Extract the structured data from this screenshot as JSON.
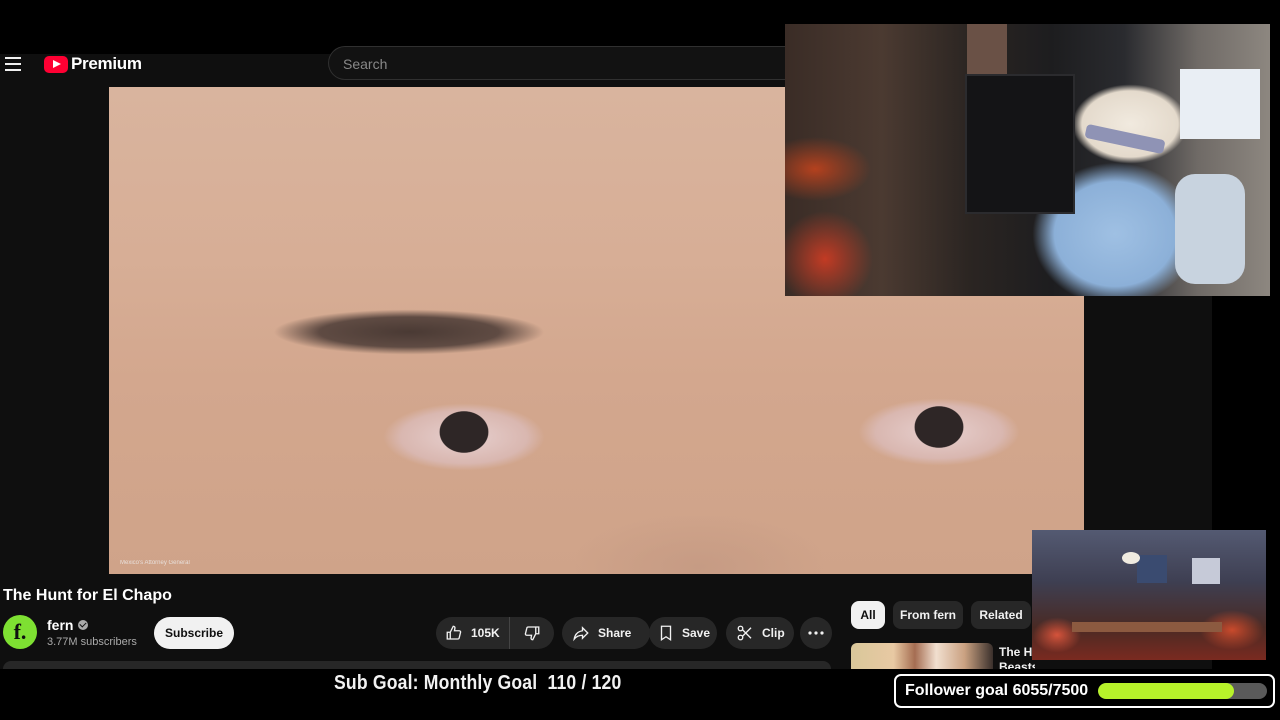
{
  "youtube": {
    "brand": "Premium",
    "search": {
      "placeholder": "Search"
    },
    "video": {
      "credit": "Mexico's Attorney General"
    },
    "title": "The Hunt for El Chapo",
    "channel": {
      "avatar_letter": "f.",
      "name": "fern",
      "subscribers": "3.77M subscribers",
      "subscribe_label": "Subscribe"
    },
    "actions": {
      "like_count": "105K",
      "share_label": "Share",
      "save_label": "Save",
      "clip_label": "Clip"
    },
    "chips": [
      "All",
      "From fern",
      "Related"
    ],
    "recommended": {
      "title_line1": "The Hu",
      "title_line2": "Beasts"
    }
  },
  "overlay": {
    "sub_goal": "Sub Goal: Monthly Goal  110 / 120",
    "follower_goal": {
      "label": "Follower goal 6055/7500",
      "current": 6055,
      "target": 7500
    }
  },
  "colors": {
    "youtube_red": "#ff0033",
    "progress": "#b7f22a",
    "channel_avatar": "#7ee032"
  }
}
